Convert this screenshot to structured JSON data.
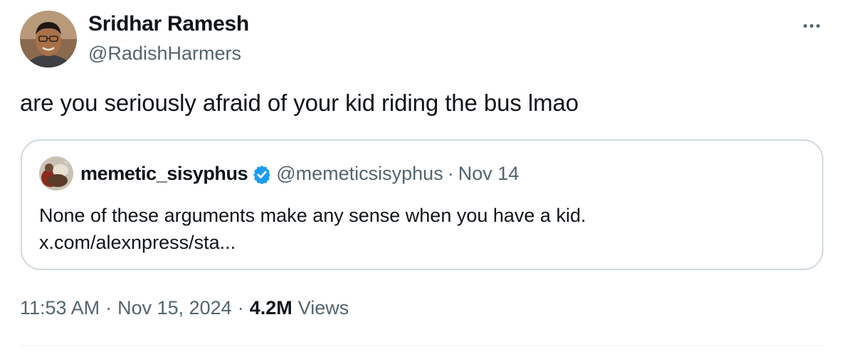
{
  "author": {
    "name": "Sridhar Ramesh",
    "handle": "@RadishHarmers",
    "avatar_icon": "profile-photo"
  },
  "more_icon": "ellipsis-icon",
  "tweet": {
    "text": "are you seriously afraid of your kid riding the bus lmao"
  },
  "quote": {
    "name": "memetic_sisyphus",
    "verified": true,
    "verified_color": "#1d9bf0",
    "handle": "@memeticsisyphus",
    "separator": "·",
    "date": "Nov 14",
    "text_line1": "None of these arguments make any sense when you have a kid.",
    "text_line2": "x.com/alexnpress/sta..."
  },
  "meta": {
    "time": "11:53 AM",
    "sep1": "·",
    "date": "Nov 15, 2024",
    "sep2": "·",
    "views_count": "4.2M",
    "views_label": "Views"
  },
  "colors": {
    "text": "#0f1419",
    "secondary": "#536471",
    "border": "#cfd9de",
    "accent": "#1d9bf0"
  }
}
